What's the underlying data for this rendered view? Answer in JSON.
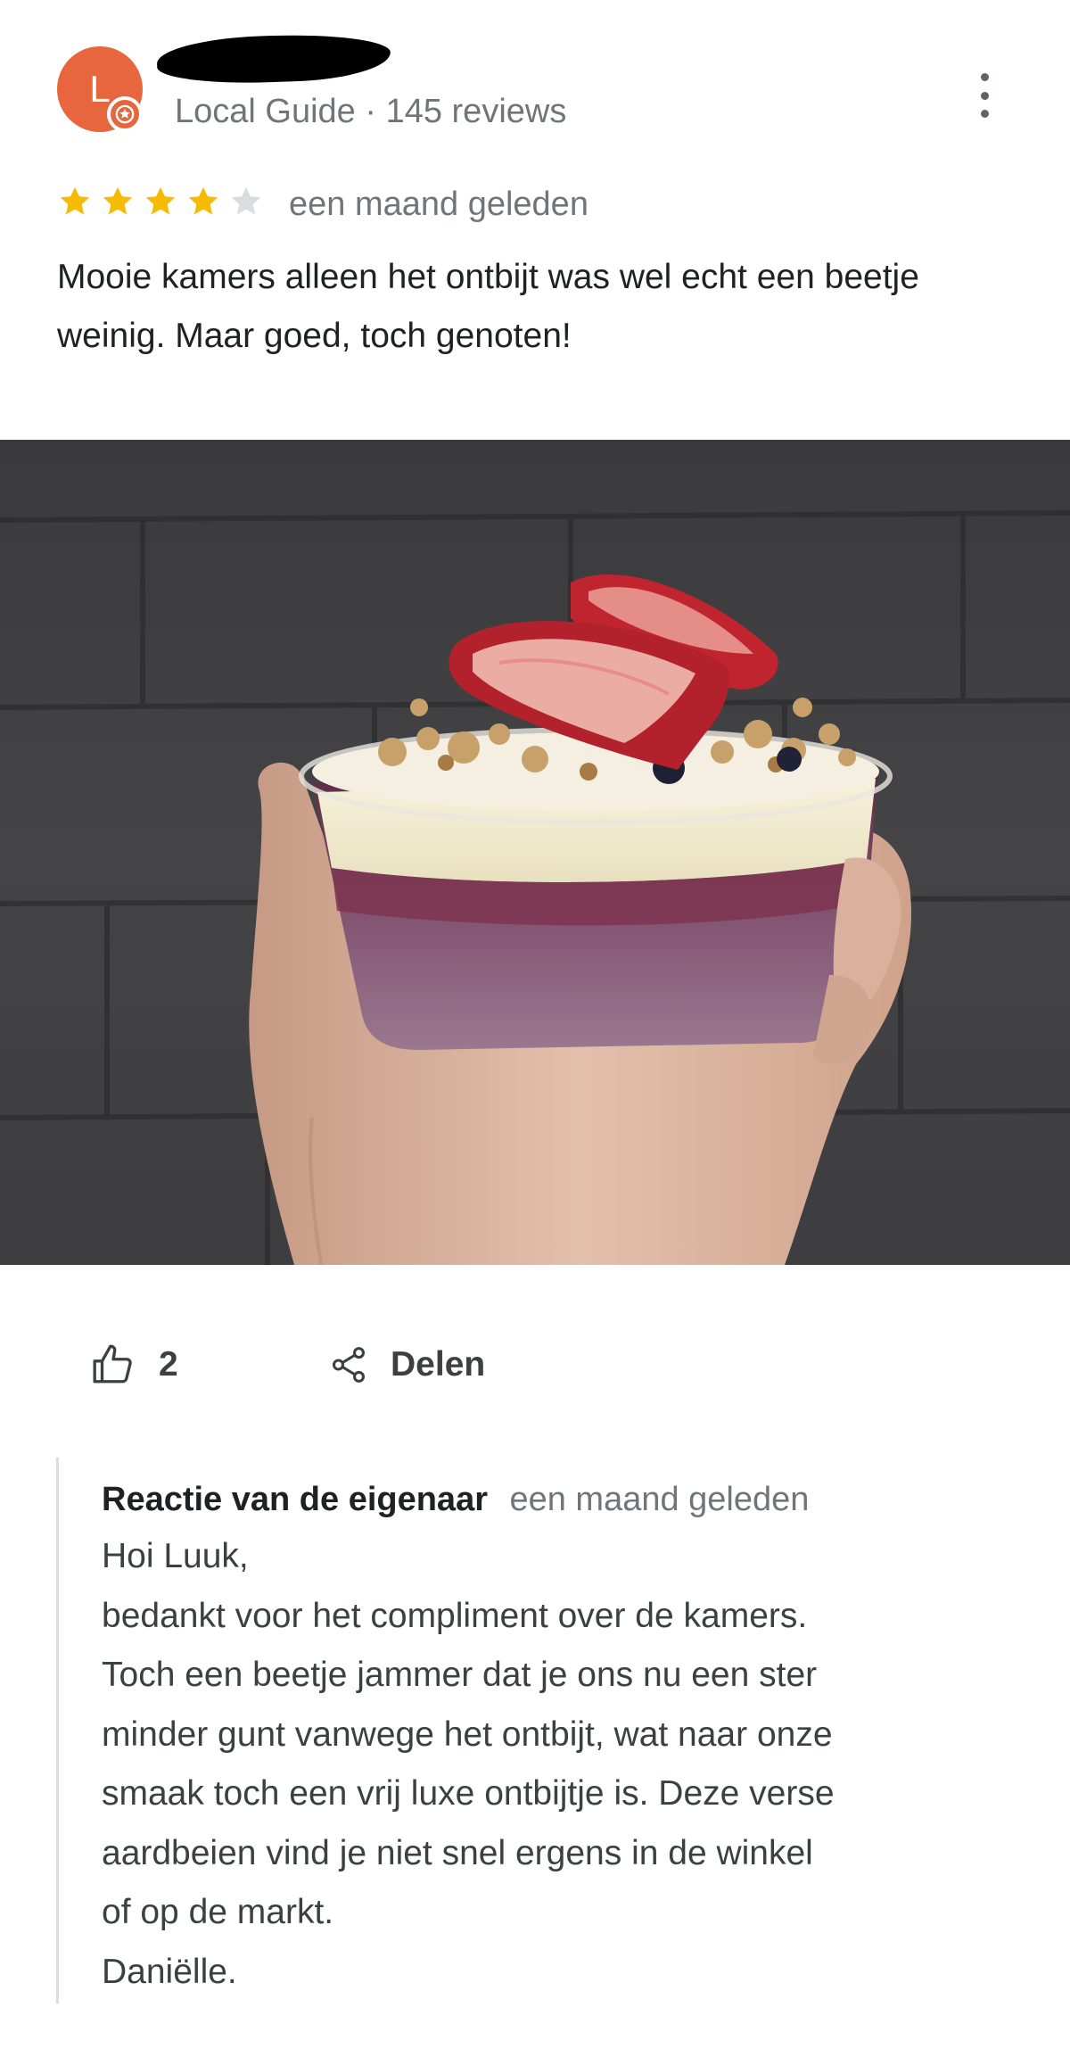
{
  "reviewer": {
    "avatar_initial": "L",
    "meta": "Local Guide · 145 reviews"
  },
  "review": {
    "rating": 4,
    "rating_max": 5,
    "date": "een maand geleden",
    "text": "Mooie kamers alleen het ontbijt was wel echt een beetje weinig. Maar goed, toch genoten!"
  },
  "actions": {
    "like_count": "2",
    "share_label": "Delen"
  },
  "owner_reply": {
    "title": "Reactie van de eigenaar",
    "date": "een maand geleden",
    "lines": [
      "Hoi Luuk,",
      "bedankt voor het compliment over de kamers.",
      "Toch een beetje jammer dat je ons nu een ster",
      "minder gunt vanwege het ontbijt, wat naar onze",
      "smaak toch een vrij luxe ontbijtje is. Deze verse",
      "aardbeien vind je niet snel ergens in de winkel",
      "of op de markt.",
      "Daniëlle."
    ]
  },
  "icons": {
    "avatar": "avatar-initial",
    "badge": "local-guide-badge-icon",
    "more": "more-vert-icon",
    "star": "star-icon",
    "like": "thumb-up-icon",
    "share": "share-icon"
  },
  "colors": {
    "avatar_bg": "#e8663d",
    "star_filled": "#f6bb06",
    "star_empty": "#dadce0",
    "secondary_text": "#70757a"
  }
}
